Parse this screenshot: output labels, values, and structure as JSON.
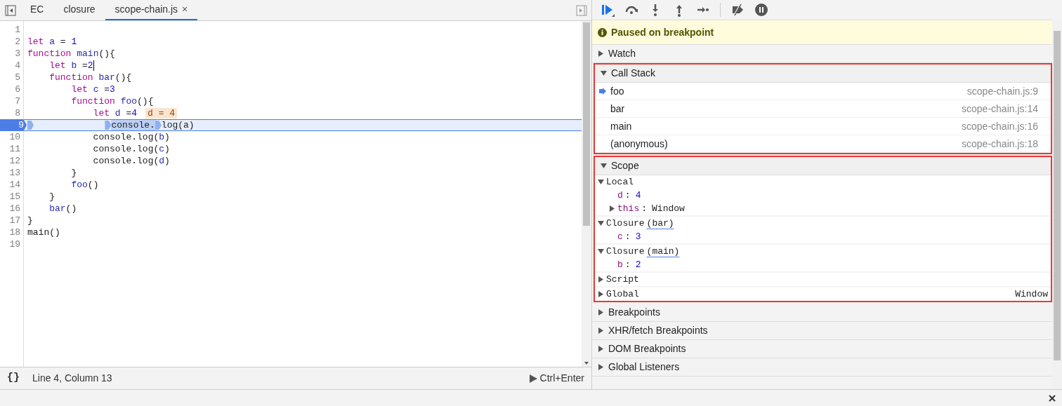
{
  "editor_tabs": [
    {
      "label": "EC",
      "selected": false,
      "closable": false
    },
    {
      "label": "closure",
      "selected": false,
      "closable": false
    },
    {
      "label": "scope-chain.js",
      "selected": true,
      "closable": true,
      "close_glyph": "×"
    }
  ],
  "code_lines": [
    {
      "number": "1",
      "current": false
    },
    {
      "number": "2",
      "current": false,
      "tokens": [
        {
          "text": "let",
          "kind": "keyword"
        },
        {
          "text": " a",
          "kind": "name"
        },
        {
          "text": " = ",
          "kind": "plain"
        },
        {
          "text": "1",
          "kind": "number"
        }
      ]
    },
    {
      "number": "3",
      "current": false,
      "tokens": [
        {
          "text": "function",
          "kind": "keyword"
        },
        {
          "text": " main",
          "kind": "name"
        },
        {
          "text": "(){",
          "kind": "plain"
        }
      ]
    },
    {
      "number": "4",
      "current": false,
      "cursor": true,
      "tokens": [
        {
          "text": "    let",
          "kind": "keyword"
        },
        {
          "text": " b",
          "kind": "name"
        },
        {
          "text": " =",
          "kind": "plain"
        },
        {
          "text": "2",
          "kind": "number"
        }
      ]
    },
    {
      "number": "5",
      "current": false,
      "tokens": [
        {
          "text": "    function",
          "kind": "keyword"
        },
        {
          "text": " bar",
          "kind": "name"
        },
        {
          "text": "(){",
          "kind": "plain"
        }
      ]
    },
    {
      "number": "6",
      "current": false,
      "tokens": [
        {
          "text": "        let",
          "kind": "keyword"
        },
        {
          "text": " c",
          "kind": "name"
        },
        {
          "text": " =",
          "kind": "plain"
        },
        {
          "text": "3",
          "kind": "number"
        }
      ]
    },
    {
      "number": "7",
      "current": false,
      "tokens": [
        {
          "text": "        function",
          "kind": "keyword"
        },
        {
          "text": " foo",
          "kind": "name"
        },
        {
          "text": "(){",
          "kind": "plain"
        }
      ]
    },
    {
      "number": "8",
      "current": false,
      "inline_value": "d = 4",
      "tokens": [
        {
          "text": "            let",
          "kind": "keyword"
        },
        {
          "text": " d",
          "kind": "name"
        },
        {
          "text": " =",
          "kind": "plain"
        },
        {
          "text": "4",
          "kind": "number"
        }
      ]
    },
    {
      "number": "9",
      "current": true,
      "line_marker": true,
      "tokens": [
        {
          "text": "             console.",
          "kind": "plain",
          "highlighted": true,
          "marker": true
        },
        {
          "text": "log(a)",
          "kind": "plain",
          "highlighted": false,
          "marker": true
        }
      ]
    },
    {
      "number": "10",
      "current": false,
      "tokens": [
        {
          "text": "            console.log(",
          "kind": "plain"
        },
        {
          "text": "b",
          "kind": "name"
        },
        {
          "text": ")",
          "kind": "plain"
        }
      ]
    },
    {
      "number": "11",
      "current": false,
      "tokens": [
        {
          "text": "            console.log(",
          "kind": "plain"
        },
        {
          "text": "c",
          "kind": "name"
        },
        {
          "text": ")",
          "kind": "plain"
        }
      ]
    },
    {
      "number": "12",
      "current": false,
      "tokens": [
        {
          "text": "            console.log(",
          "kind": "plain"
        },
        {
          "text": "d",
          "kind": "name"
        },
        {
          "text": ")",
          "kind": "plain"
        }
      ]
    },
    {
      "number": "13",
      "current": false,
      "tokens": [
        {
          "text": "        }",
          "kind": "plain"
        }
      ]
    },
    {
      "number": "14",
      "current": false,
      "tokens": [
        {
          "text": "        foo",
          "kind": "name"
        },
        {
          "text": "()",
          "kind": "plain"
        }
      ]
    },
    {
      "number": "15",
      "current": false,
      "tokens": [
        {
          "text": "    }",
          "kind": "plain"
        }
      ]
    },
    {
      "number": "16",
      "current": false,
      "tokens": [
        {
          "text": "    bar",
          "kind": "name"
        },
        {
          "text": "()",
          "kind": "plain"
        }
      ]
    },
    {
      "number": "17",
      "current": false,
      "tokens": [
        {
          "text": "}",
          "kind": "plain"
        }
      ]
    },
    {
      "number": "18",
      "current": false,
      "tokens": [
        {
          "text": "main",
          "kind": "plain"
        },
        {
          "text": "()",
          "kind": "plain"
        }
      ]
    },
    {
      "number": "19",
      "current": false
    }
  ],
  "status_bar": {
    "format_label": "{}",
    "position": "Line 4, Column 13",
    "run_label": "Ctrl+Enter"
  },
  "paused_banner": "Paused on breakpoint",
  "sections": [
    {
      "kind": "plain",
      "title": "Watch",
      "expanded": false,
      "highlighted": false
    },
    {
      "kind": "call_stack",
      "title": "Call Stack",
      "expanded": true,
      "highlighted": true,
      "frames": [
        {
          "name": "foo",
          "location": "scope-chain.js:9",
          "selected": true
        },
        {
          "name": "bar",
          "location": "scope-chain.js:14",
          "selected": false
        },
        {
          "name": "main",
          "location": "scope-chain.js:16",
          "selected": false
        },
        {
          "name": "(anonymous)",
          "location": "scope-chain.js:18",
          "selected": false
        }
      ]
    },
    {
      "kind": "scope",
      "title": "Scope",
      "expanded": true,
      "highlighted": true,
      "items": [
        {
          "label": "Local",
          "expanded": true,
          "children": [
            {
              "key": "d",
              "separator": ":",
              "value": "4",
              "kind": "number"
            },
            {
              "key": "this",
              "separator": ":",
              "value": "Window",
              "kind": "object",
              "expanded": false
            }
          ]
        },
        {
          "label": "Closure",
          "qualifier": "(bar)",
          "expanded": true,
          "children": [
            {
              "key": "c",
              "separator": ":",
              "value": "3",
              "kind": "number"
            }
          ]
        },
        {
          "label": "Closure",
          "qualifier": "(main)",
          "expanded": true,
          "children": [
            {
              "key": "b",
              "separator": ":",
              "value": "2",
              "kind": "number"
            }
          ]
        },
        {
          "label": "Script",
          "expanded": false
        },
        {
          "label": "Global",
          "value": "Window",
          "expanded": false
        }
      ]
    },
    {
      "kind": "plain",
      "title": "Breakpoints",
      "expanded": false,
      "highlighted": false
    },
    {
      "kind": "plain",
      "title": "XHR/fetch Breakpoints",
      "expanded": false,
      "highlighted": false
    },
    {
      "kind": "plain",
      "title": "DOM Breakpoints",
      "expanded": false,
      "highlighted": false
    },
    {
      "kind": "plain",
      "title": "Global Listeners",
      "expanded": false,
      "highlighted": false
    }
  ]
}
